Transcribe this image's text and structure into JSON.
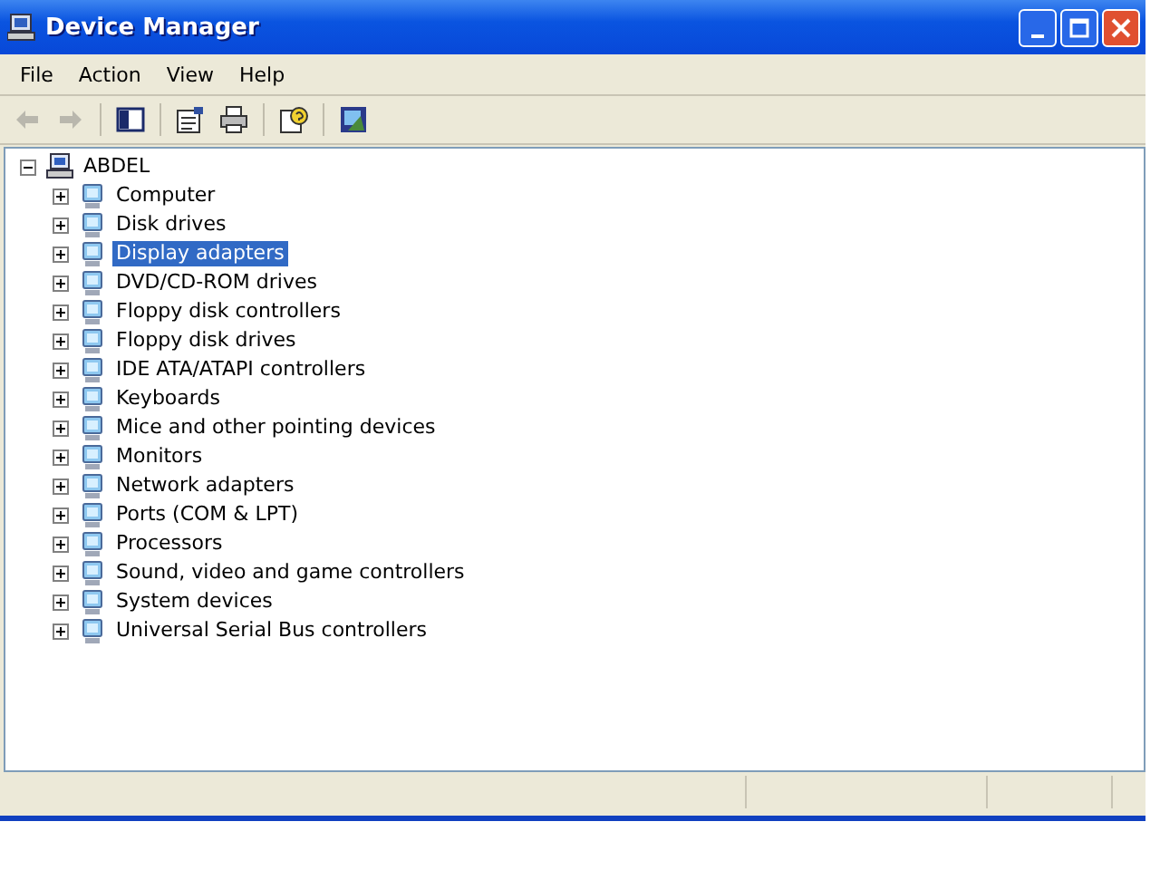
{
  "window": {
    "title": "Device Manager"
  },
  "menu": [
    "File",
    "Action",
    "View",
    "Help"
  ],
  "toolbar": [
    [
      {
        "kind": "back",
        "disabled": true
      },
      {
        "kind": "forward",
        "disabled": true
      }
    ],
    [
      {
        "kind": "tree",
        "disabled": false
      }
    ],
    [
      {
        "kind": "properties",
        "disabled": false
      },
      {
        "kind": "print",
        "disabled": false
      }
    ],
    [
      {
        "kind": "help",
        "disabled": false
      }
    ],
    [
      {
        "kind": "scan",
        "disabled": false
      }
    ]
  ],
  "tree": {
    "label": "ABDEL",
    "expanded": true,
    "selected": false,
    "children": [
      {
        "label": "Computer",
        "expanded": false,
        "selected": false
      },
      {
        "label": "Disk drives",
        "expanded": false,
        "selected": false
      },
      {
        "label": "Display adapters",
        "expanded": false,
        "selected": true
      },
      {
        "label": "DVD/CD-ROM drives",
        "expanded": false,
        "selected": false
      },
      {
        "label": "Floppy disk controllers",
        "expanded": false,
        "selected": false
      },
      {
        "label": "Floppy disk drives",
        "expanded": false,
        "selected": false
      },
      {
        "label": "IDE ATA/ATAPI controllers",
        "expanded": false,
        "selected": false
      },
      {
        "label": "Keyboards",
        "expanded": false,
        "selected": false
      },
      {
        "label": "Mice and other pointing devices",
        "expanded": false,
        "selected": false
      },
      {
        "label": "Monitors",
        "expanded": false,
        "selected": false
      },
      {
        "label": "Network adapters",
        "expanded": false,
        "selected": false
      },
      {
        "label": "Ports (COM & LPT)",
        "expanded": false,
        "selected": false
      },
      {
        "label": "Processors",
        "expanded": false,
        "selected": false
      },
      {
        "label": "Sound, video and game controllers",
        "expanded": false,
        "selected": false
      },
      {
        "label": "System devices",
        "expanded": false,
        "selected": false
      },
      {
        "label": "Universal Serial Bus controllers",
        "expanded": false,
        "selected": false
      }
    ]
  }
}
